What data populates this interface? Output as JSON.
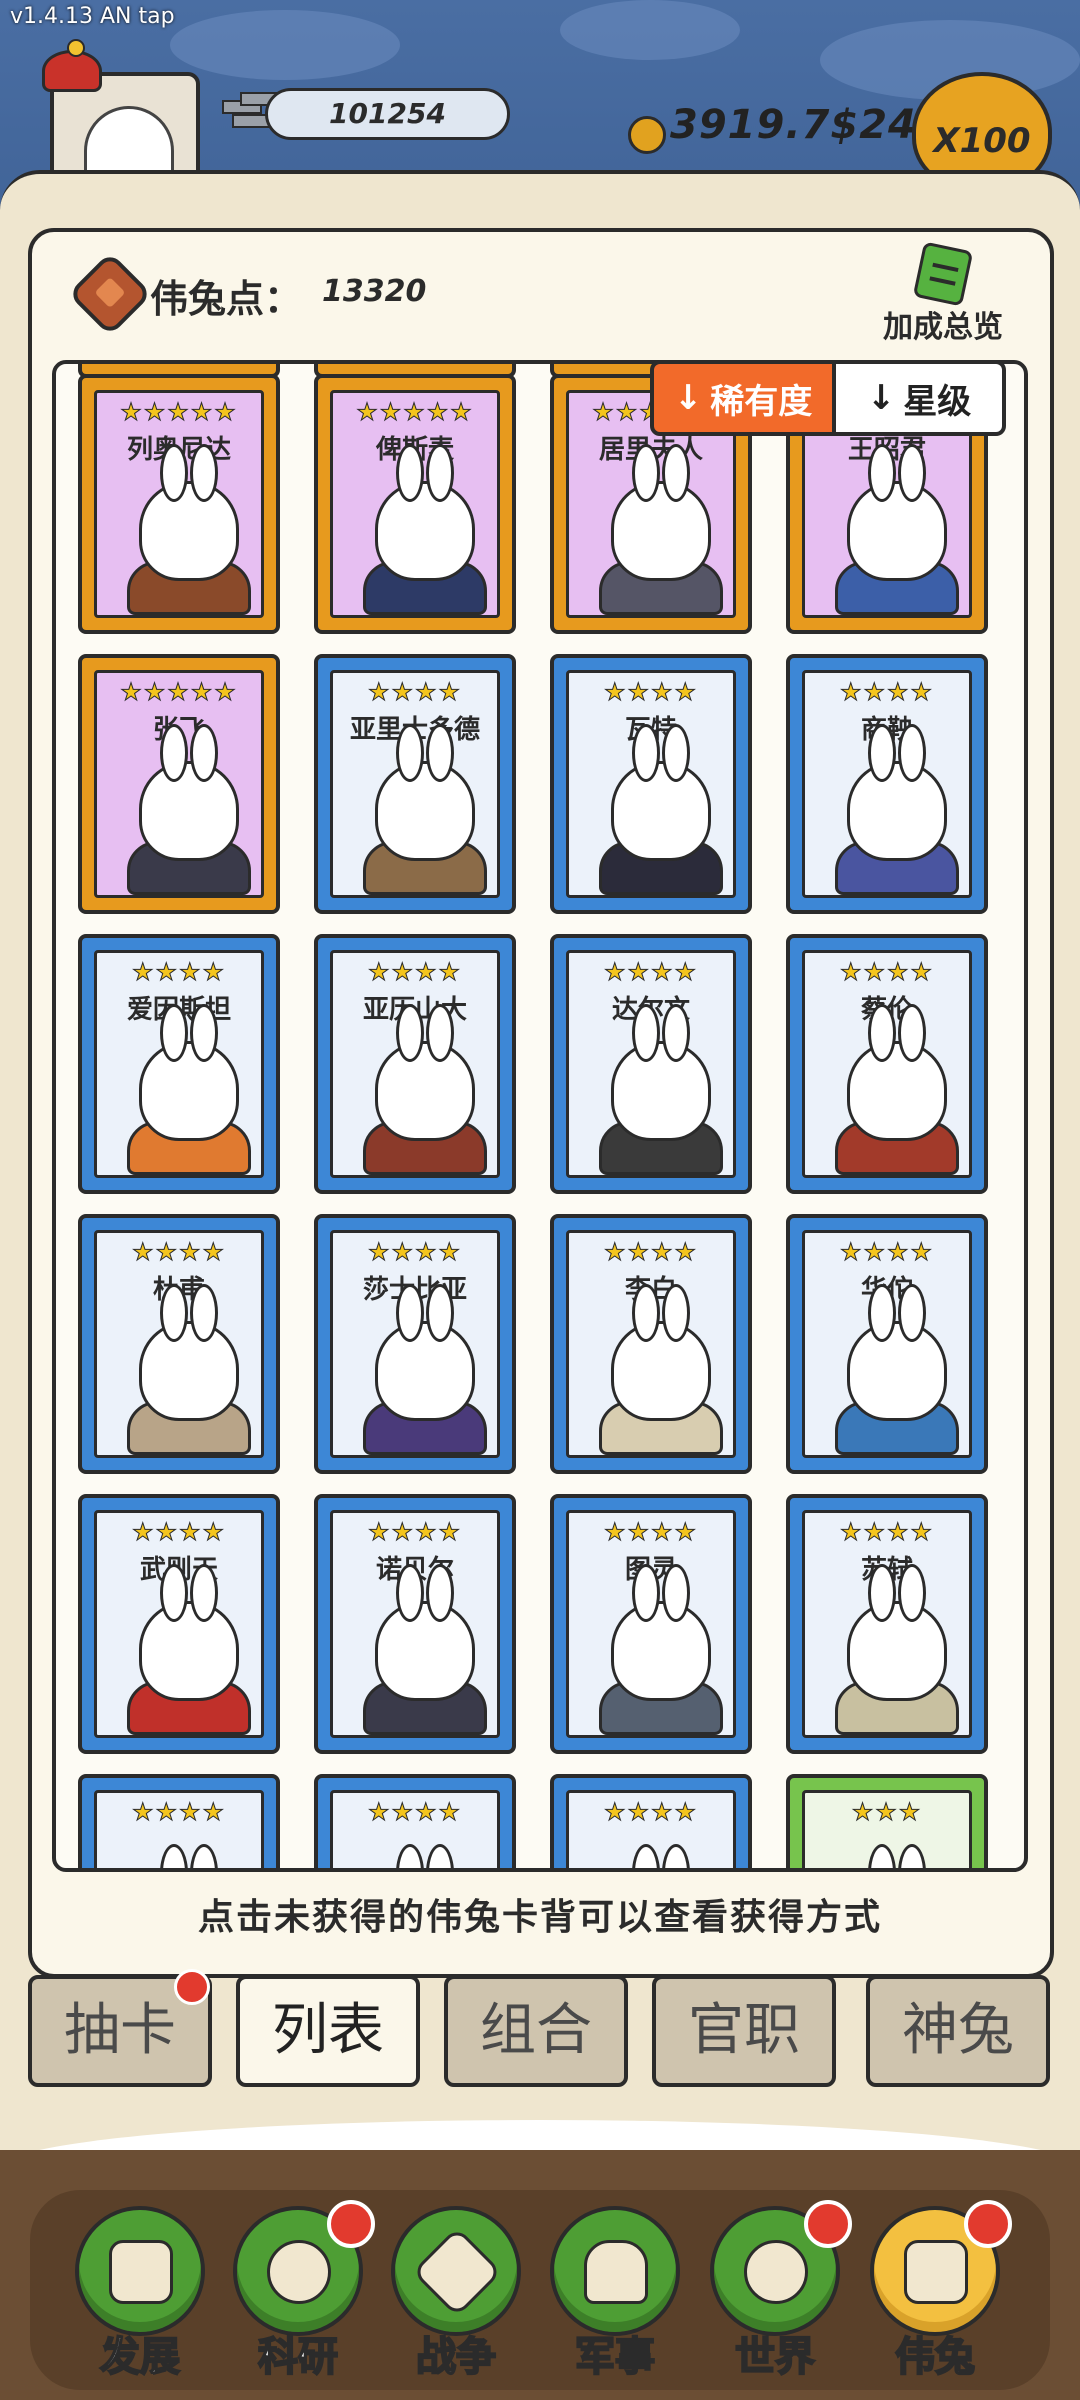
{
  "version": "v1.4.13 AN tap",
  "header": {
    "silver": "101254",
    "gold": "3919.7$2442",
    "multiplier": "X100"
  },
  "points": {
    "label": "伟兔点：",
    "value": "13320"
  },
  "bonus_label": "加成总览",
  "sort": {
    "rarity": "稀有度",
    "star": "星级",
    "arrow": "↓"
  },
  "cards": [
    {
      "name": "列奥尼达",
      "stars": "★★★★★",
      "tier": "gold",
      "outfit": "#8a4a2a"
    },
    {
      "name": "俾斯麦",
      "stars": "★★★★★",
      "tier": "gold",
      "outfit": "#2d3a66"
    },
    {
      "name": "居里夫人",
      "stars": "★★★★★",
      "tier": "gold",
      "outfit": "#555566"
    },
    {
      "name": "王昭君",
      "stars": "★★★★★",
      "tier": "gold",
      "outfit": "#3c5fa8"
    },
    {
      "name": "张飞",
      "stars": "★★★★★",
      "tier": "gold",
      "outfit": "#3a3a4a"
    },
    {
      "name": "亚里士多德",
      "stars": "★★★★",
      "tier": "blue",
      "outfit": "#8b6b48"
    },
    {
      "name": "瓦特",
      "stars": "★★★★",
      "tier": "blue",
      "outfit": "#2b2b3a"
    },
    {
      "name": "商鞅",
      "stars": "★★★★",
      "tier": "blue",
      "outfit": "#4a55a0"
    },
    {
      "name": "爱因斯坦",
      "stars": "★★★★",
      "tier": "blue",
      "outfit": "#e07a30"
    },
    {
      "name": "亚历山大",
      "stars": "★★★★",
      "tier": "blue",
      "outfit": "#8b3a2a"
    },
    {
      "name": "达尔文",
      "stars": "★★★★",
      "tier": "blue",
      "outfit": "#3a3a3a"
    },
    {
      "name": "蔡伦",
      "stars": "★★★★",
      "tier": "blue",
      "outfit": "#a23a2a"
    },
    {
      "name": "杜甫",
      "stars": "★★★★",
      "tier": "blue",
      "outfit": "#b8a488"
    },
    {
      "name": "莎士比亚",
      "stars": "★★★★",
      "tier": "blue",
      "outfit": "#4a3a7a"
    },
    {
      "name": "李白",
      "stars": "★★★★",
      "tier": "blue",
      "outfit": "#d8cdb0"
    },
    {
      "name": "华佗",
      "stars": "★★★★",
      "tier": "blue",
      "outfit": "#3a78b8"
    },
    {
      "name": "武则天",
      "stars": "★★★★",
      "tier": "blue",
      "outfit": "#c0302a"
    },
    {
      "name": "诺贝尔",
      "stars": "★★★★",
      "tier": "blue",
      "outfit": "#3a3a4a"
    },
    {
      "name": "图灵",
      "stars": "★★★★",
      "tier": "blue",
      "outfit": "#556070"
    },
    {
      "name": "苏轼",
      "stars": "★★★★",
      "tier": "blue",
      "outfit": "#c8c0a0"
    },
    {
      "name": "",
      "stars": "★★★★",
      "tier": "blue",
      "outfit": "#c8c0a0"
    },
    {
      "name": "",
      "stars": "★★★★",
      "tier": "blue",
      "outfit": "#c8c0a0"
    },
    {
      "name": "",
      "stars": "★★★★",
      "tier": "blue",
      "outfit": "#c8c0a0"
    },
    {
      "name": "",
      "stars": "★★★",
      "tier": "green",
      "outfit": "#c8c0a0"
    }
  ],
  "hint": "点击未获得的伟兔卡背可以查看获得方式",
  "tabs": [
    "抽卡",
    "列表",
    "组合",
    "官职",
    "神兔"
  ],
  "nav": [
    "发展",
    "科研",
    "战争",
    "军事",
    "世界",
    "伟兔"
  ]
}
